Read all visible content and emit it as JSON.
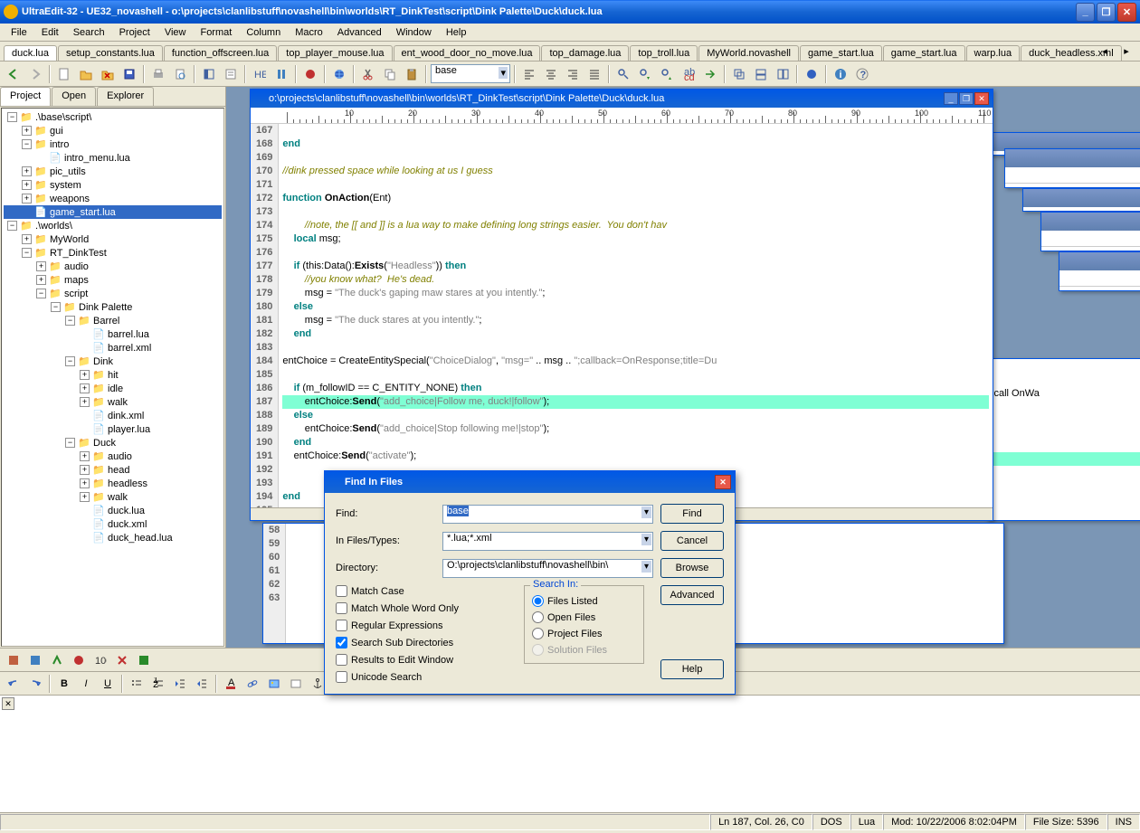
{
  "title": "UltraEdit-32 - UE32_novashell - o:\\projects\\clanlibstuff\\novashell\\bin\\worlds\\RT_DinkTest\\script\\Dink Palette\\Duck\\duck.lua",
  "menu": [
    "File",
    "Edit",
    "Search",
    "Project",
    "View",
    "Format",
    "Column",
    "Macro",
    "Advanced",
    "Window",
    "Help"
  ],
  "tabs": [
    "duck.lua",
    "setup_constants.lua",
    "function_offscreen.lua",
    "top_player_mouse.lua",
    "ent_wood_door_no_move.lua",
    "top_damage.lua",
    "top_troll.lua",
    "MyWorld.novashell",
    "game_start.lua",
    "game_start.lua",
    "warp.lua",
    "duck_headless.xml"
  ],
  "active_tab": "duck.lua",
  "combo_value": "base",
  "sidebar_tabs": [
    "Project",
    "Open",
    "Explorer"
  ],
  "active_sidebar_tab": "Project",
  "tree": [
    {
      "d": 0,
      "exp": "-",
      "t": "folder",
      "label": ".\\base\\script\\"
    },
    {
      "d": 1,
      "exp": "+",
      "t": "folder",
      "label": "gui"
    },
    {
      "d": 1,
      "exp": "-",
      "t": "folder",
      "label": "intro"
    },
    {
      "d": 2,
      "exp": "",
      "t": "file",
      "label": "intro_menu.lua"
    },
    {
      "d": 1,
      "exp": "+",
      "t": "folder",
      "label": "pic_utils"
    },
    {
      "d": 1,
      "exp": "+",
      "t": "folder",
      "label": "system"
    },
    {
      "d": 1,
      "exp": "+",
      "t": "folder",
      "label": "weapons"
    },
    {
      "d": 1,
      "exp": "",
      "t": "file",
      "label": "game_start.lua",
      "selected": true
    },
    {
      "d": 0,
      "exp": "-",
      "t": "folder",
      "label": ".\\worlds\\"
    },
    {
      "d": 1,
      "exp": "+",
      "t": "folder",
      "label": "MyWorld"
    },
    {
      "d": 1,
      "exp": "-",
      "t": "folder",
      "label": "RT_DinkTest"
    },
    {
      "d": 2,
      "exp": "+",
      "t": "folder",
      "label": "audio"
    },
    {
      "d": 2,
      "exp": "+",
      "t": "folder",
      "label": "maps"
    },
    {
      "d": 2,
      "exp": "-",
      "t": "folder",
      "label": "script"
    },
    {
      "d": 3,
      "exp": "-",
      "t": "folder",
      "label": "Dink Palette"
    },
    {
      "d": 4,
      "exp": "-",
      "t": "folder",
      "label": "Barrel"
    },
    {
      "d": 5,
      "exp": "",
      "t": "file",
      "label": "barrel.lua"
    },
    {
      "d": 5,
      "exp": "",
      "t": "file",
      "label": "barrel.xml"
    },
    {
      "d": 4,
      "exp": "-",
      "t": "folder",
      "label": "Dink"
    },
    {
      "d": 5,
      "exp": "+",
      "t": "folder",
      "label": "hit"
    },
    {
      "d": 5,
      "exp": "+",
      "t": "folder",
      "label": "idle"
    },
    {
      "d": 5,
      "exp": "+",
      "t": "folder",
      "label": "walk"
    },
    {
      "d": 5,
      "exp": "",
      "t": "file",
      "label": "dink.xml"
    },
    {
      "d": 5,
      "exp": "",
      "t": "file",
      "label": "player.lua"
    },
    {
      "d": 4,
      "exp": "-",
      "t": "folder",
      "label": "Duck"
    },
    {
      "d": 5,
      "exp": "+",
      "t": "folder",
      "label": "audio"
    },
    {
      "d": 5,
      "exp": "+",
      "t": "folder",
      "label": "head"
    },
    {
      "d": 5,
      "exp": "+",
      "t": "folder",
      "label": "headless"
    },
    {
      "d": 5,
      "exp": "+",
      "t": "folder",
      "label": "walk"
    },
    {
      "d": 5,
      "exp": "",
      "t": "file",
      "label": "duck.lua"
    },
    {
      "d": 5,
      "exp": "",
      "t": "file",
      "label": "duck.xml"
    },
    {
      "d": 5,
      "exp": "",
      "t": "file",
      "label": "duck_head.lua"
    }
  ],
  "doc_title": "o:\\projects\\clanlibstuff\\novashell\\bin\\worlds\\RT_DinkTest\\script\\Dink Palette\\Duck\\duck.lua",
  "line_start": 167,
  "line_end": 196,
  "code_html": [
    "",
    "<span class='kw'>end</span>",
    "",
    "<span class='cm'>//dink pressed space while looking at us I guess</span>",
    "",
    "<span class='kw'>function</span> <span class='fn'>OnAction</span>(Ent)",
    "",
    "        <span class='cm'>//note, the [[ and ]] is a lua way to make defining long strings easier.  You don't hav</span>",
    "    <span class='kw'>local</span> msg;",
    "",
    "    <span class='kw'>if</span> (this:Data():<span class='fn'>Exists</span>(<span class='st'>\"Headless\"</span>)) <span class='kw'>then</span>",
    "        <span class='cm'>//you know what?  He's dead.</span>",
    "        msg = <span class='st'>\"The duck's gaping maw stares at you intently.\"</span>;",
    "    <span class='kw'>else</span>",
    "        msg = <span class='st'>\"The duck stares at you intently.\"</span>;",
    "    <span class='kw'>end</span>",
    "",
    "entChoice = CreateEntitySpecial(<span class='st'>\"ChoiceDialog\"</span>, <span class='st'>\"msg=\"</span> .. msg .. <span class='st'>\";callback=OnResponse;title=Du</span>",
    "",
    "    <span class='kw'>if</span> (m_followID == C_ENTITY_NONE) <span class='kw'>then</span>",
    "        entChoice:<span class='fn'>Send</span>(<span class='st'>\"add_choice|Follow me, duck!|follow\"</span>);",
    "    <span class='kw'>else</span>",
    "        entChoice:<span class='fn'>Send</span>(<span class='st'>\"add_choice|Stop following me!|stop\"</span>);",
    "    <span class='kw'>end</span>",
    "    entChoice:<span class='fn'>Send</span>(<span class='st'>\"activate\"</span>);",
    "",
    "",
    "<span class='kw'>end</span>",
    "",
    ""
  ],
  "highlighted_line_index": 20,
  "secondary_gutter": [
    58,
    59,
    60,
    61,
    62,
    63
  ],
  "dialog": {
    "title": "Find In Files",
    "find_label": "Find:",
    "find_value": "base",
    "files_label": "In Files/Types:",
    "files_value": "*.lua;*.xml",
    "dir_label": "Directory:",
    "dir_value": "O:\\projects\\clanlibstuff\\novashell\\bin\\",
    "btn_find": "Find",
    "btn_cancel": "Cancel",
    "btn_browse": "Browse",
    "btn_advanced": "Advanced",
    "btn_help": "Help",
    "checks": [
      {
        "label": "Match Case",
        "checked": false
      },
      {
        "label": "Match Whole Word Only",
        "checked": false
      },
      {
        "label": "Regular Expressions",
        "checked": false
      },
      {
        "label": "Search Sub Directories",
        "checked": true
      },
      {
        "label": "Results to Edit Window",
        "checked": false
      },
      {
        "label": "Unicode Search",
        "checked": false
      }
    ],
    "search_in_legend": "Search In:",
    "radios": [
      {
        "label": "Files Listed",
        "checked": true,
        "enabled": true
      },
      {
        "label": "Open Files",
        "checked": false,
        "enabled": true
      },
      {
        "label": "Project Files",
        "checked": false,
        "enabled": true
      },
      {
        "label": "Solution Files",
        "checked": false,
        "enabled": false
      }
    ]
  },
  "status": {
    "pos": "Ln 187, Col. 26, C0",
    "enc": "DOS",
    "lang": "Lua",
    "mod": "Mod: 10/22/2006 8:02:04PM",
    "size": "File Size: 5396",
    "ins": "INS"
  },
  "bg_text": "l call OnWa",
  "bg_ruler_hint": "100"
}
